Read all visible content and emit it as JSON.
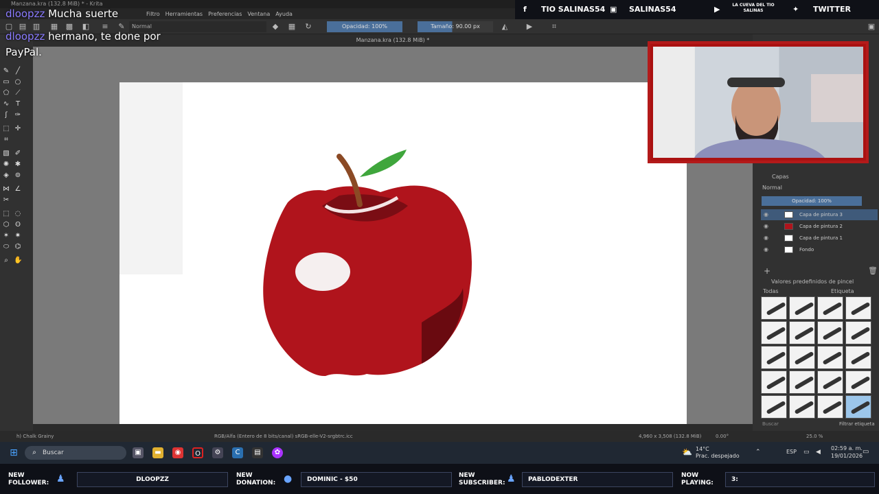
{
  "window": {
    "title": "Manzana.kra (132.8 MiB) * - Krita",
    "document_tab": "Manzana.kra (132.8 MiB) *"
  },
  "menu": [
    "Filtro",
    "Herramientas",
    "Preferencias",
    "Ventana",
    "Ayuda"
  ],
  "toolbar": {
    "blend_mode": "Normal",
    "opacity": "Opacidad: 100%",
    "size": "Tamaño: 90.00 px"
  },
  "chat": [
    {
      "user": "dloopzz",
      "text": "Mucha suerte"
    },
    {
      "user": "dloopzz",
      "text": "hermano, te done por PayPal."
    }
  ],
  "social": {
    "facebook": "TIO SALINAS54",
    "twitch": "SALINAS54",
    "youtube": "LA CUEVA DEL TIO SALINAS",
    "twitter": "TWITTER"
  },
  "layers": {
    "title": "Capas",
    "blend": "Normal",
    "opacity": "Opacidad: 100%",
    "items": [
      {
        "name": "Capa de pintura 3"
      },
      {
        "name": "Capa de pintura 2"
      },
      {
        "name": "Capa de pintura 1"
      },
      {
        "name": "Fondo"
      }
    ]
  },
  "brushes": {
    "title": "Valores predefinidos de pincel",
    "filter_all": "Todas",
    "tag_label": "Etiqueta",
    "filter_tag": "Filtrar etiqueta",
    "search_placeholder": "Buscar"
  },
  "status": {
    "brush": "h) Chalk Grainy",
    "color_space": "RGB/Alfa (Entero de 8 bits/canal)  sRGB-elle-V2-srgbtrc.icc",
    "dimensions": "4,960 x 3,508 (132.8 MiB)",
    "rotation": "0.00°",
    "zoom": "25.0 %"
  },
  "taskbar": {
    "search": "Buscar",
    "weather_temp": "14°C",
    "weather_desc": "Prac. despejado",
    "lang": "ESP",
    "time": "02:59 a. m.",
    "date": "19/01/2026"
  },
  "alerts": {
    "follower_label_1": "NEW",
    "follower_label_2": "FOLLOWER:",
    "follower": "DLOOPZZ",
    "donation_label_1": "NEW",
    "donation_label_2": "DONATION:",
    "donation": "DOMINIC - $50",
    "subscriber_label_1": "NEW",
    "subscriber_label_2": "SUBSCRIBER:",
    "subscriber": "PABLODEXTER",
    "playing_label_1": "NOW",
    "playing_label_2": "PLAYING:",
    "playing": "3:"
  },
  "colors": {
    "accent": "#4a6f9a",
    "apple": "#b0141c",
    "webcam_frame": "#b31a1a"
  }
}
